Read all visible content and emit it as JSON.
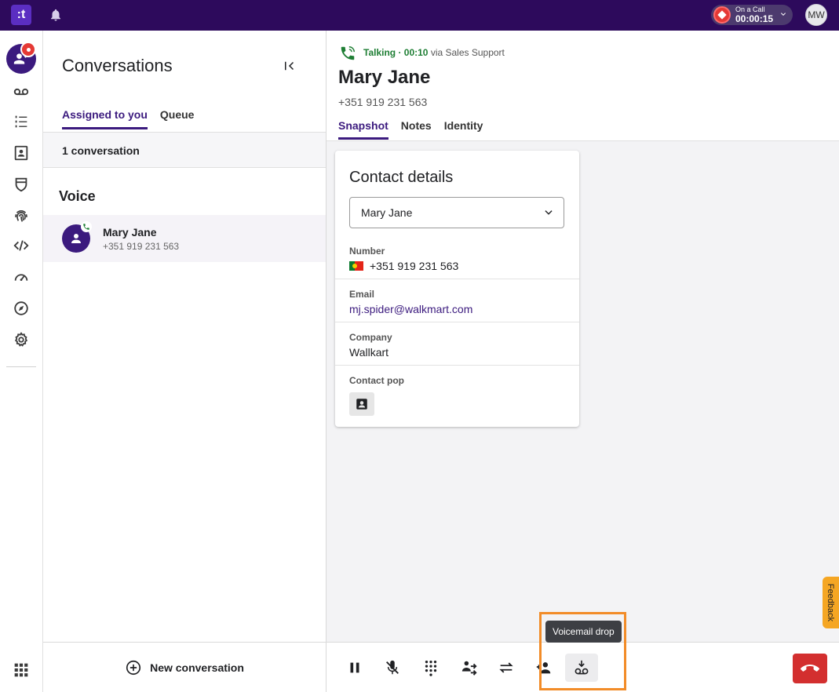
{
  "topbar": {
    "logo": ":t",
    "on_call_label": "On a Call",
    "on_call_timer": "00:00:15",
    "user_initials": "MW"
  },
  "sidebar": {
    "items": [
      {
        "icon": "conversations-icon",
        "active": true
      },
      {
        "icon": "voicemail-icon"
      },
      {
        "icon": "list-icon"
      },
      {
        "icon": "contacts-icon"
      },
      {
        "icon": "shield-icon"
      },
      {
        "icon": "fingerprint-icon"
      },
      {
        "icon": "code-icon"
      },
      {
        "icon": "dashboard-icon"
      },
      {
        "icon": "compass-icon"
      },
      {
        "icon": "settings-icon"
      }
    ]
  },
  "conversations": {
    "title": "Conversations",
    "tabs": [
      {
        "label": "Assigned to you",
        "active": true
      },
      {
        "label": "Queue",
        "active": false
      }
    ],
    "count_label": "1 conversation",
    "section": "Voice",
    "items": [
      {
        "name": "Mary Jane",
        "number": "+351 919 231 563"
      }
    ],
    "new_conversation_label": "New conversation"
  },
  "call": {
    "status_talking": "Talking · 00:10",
    "status_via": "via Sales Support",
    "contact_name": "Mary Jane",
    "contact_number": "+351 919 231 563",
    "tabs": [
      {
        "label": "Snapshot",
        "active": true
      },
      {
        "label": "Notes",
        "active": false
      },
      {
        "label": "Identity",
        "active": false
      }
    ]
  },
  "contact_card": {
    "title": "Contact details",
    "selected_contact": "Mary Jane",
    "fields": {
      "number_label": "Number",
      "number_value": "+351 919 231 563",
      "email_label": "Email",
      "email_value": "mj.spider@walkmart.com",
      "company_label": "Company",
      "company_value": "Wallkart",
      "contact_pop_label": "Contact pop"
    }
  },
  "controls": {
    "tooltip": "Voicemail drop",
    "buttons": [
      "pause-icon",
      "mute-icon",
      "dialpad-icon",
      "transfer-icon",
      "swap-icon",
      "add-participant-icon",
      "voicemail-drop-icon"
    ],
    "highlight_color": "#f28c28"
  },
  "feedback_label": "Feedback",
  "colors": {
    "brand": "#3b1a7e",
    "topbar": "#2d0a5c",
    "talking": "#1e7e34",
    "hangup": "#d32f2f"
  }
}
